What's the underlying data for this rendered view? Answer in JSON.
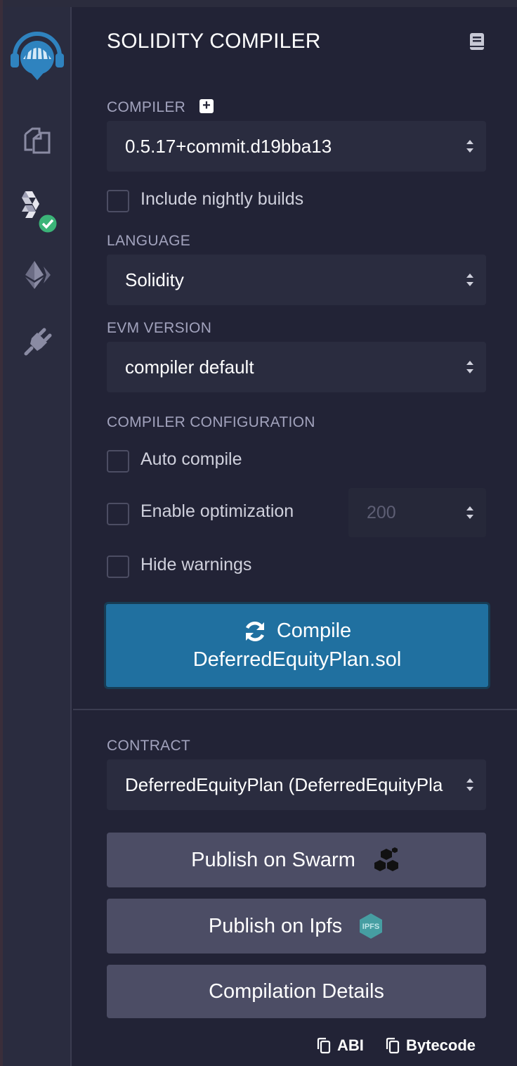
{
  "panel": {
    "title": "SOLIDITY COMPILER"
  },
  "compiler": {
    "label": "COMPILER",
    "version": "0.5.17+commit.d19bba13",
    "nightly_label": "Include nightly builds"
  },
  "language": {
    "label": "LANGUAGE",
    "value": "Solidity"
  },
  "evm": {
    "label": "EVM VERSION",
    "value": "compiler default"
  },
  "config": {
    "label": "COMPILER CONFIGURATION",
    "auto_compile": "Auto compile",
    "enable_optimization": "Enable optimization",
    "runs": "200",
    "hide_warnings": "Hide warnings"
  },
  "compile_button": {
    "line1": "Compile",
    "line2": "DeferredEquityPlan.sol"
  },
  "contract": {
    "label": "CONTRACT",
    "value": "DeferredEquityPlan (DeferredEquityPla"
  },
  "actions": {
    "swarm": "Publish on Swarm",
    "ipfs": "Publish on Ipfs",
    "ipfs_badge": "IPFS",
    "details": "Compilation Details"
  },
  "footer": {
    "abi": "ABI",
    "bytecode": "Bytecode"
  },
  "colors": {
    "background": "#222336",
    "accent": "#2070a0",
    "success": "#3bb478"
  },
  "icons": [
    "remix-logo-icon",
    "file-explorer-icon",
    "solidity-compiler-icon",
    "deploy-ethereum-icon",
    "plugin-manager-icon",
    "documentation-icon",
    "copy-icon",
    "refresh-icon",
    "swarm-icon",
    "ipfs-icon"
  ]
}
